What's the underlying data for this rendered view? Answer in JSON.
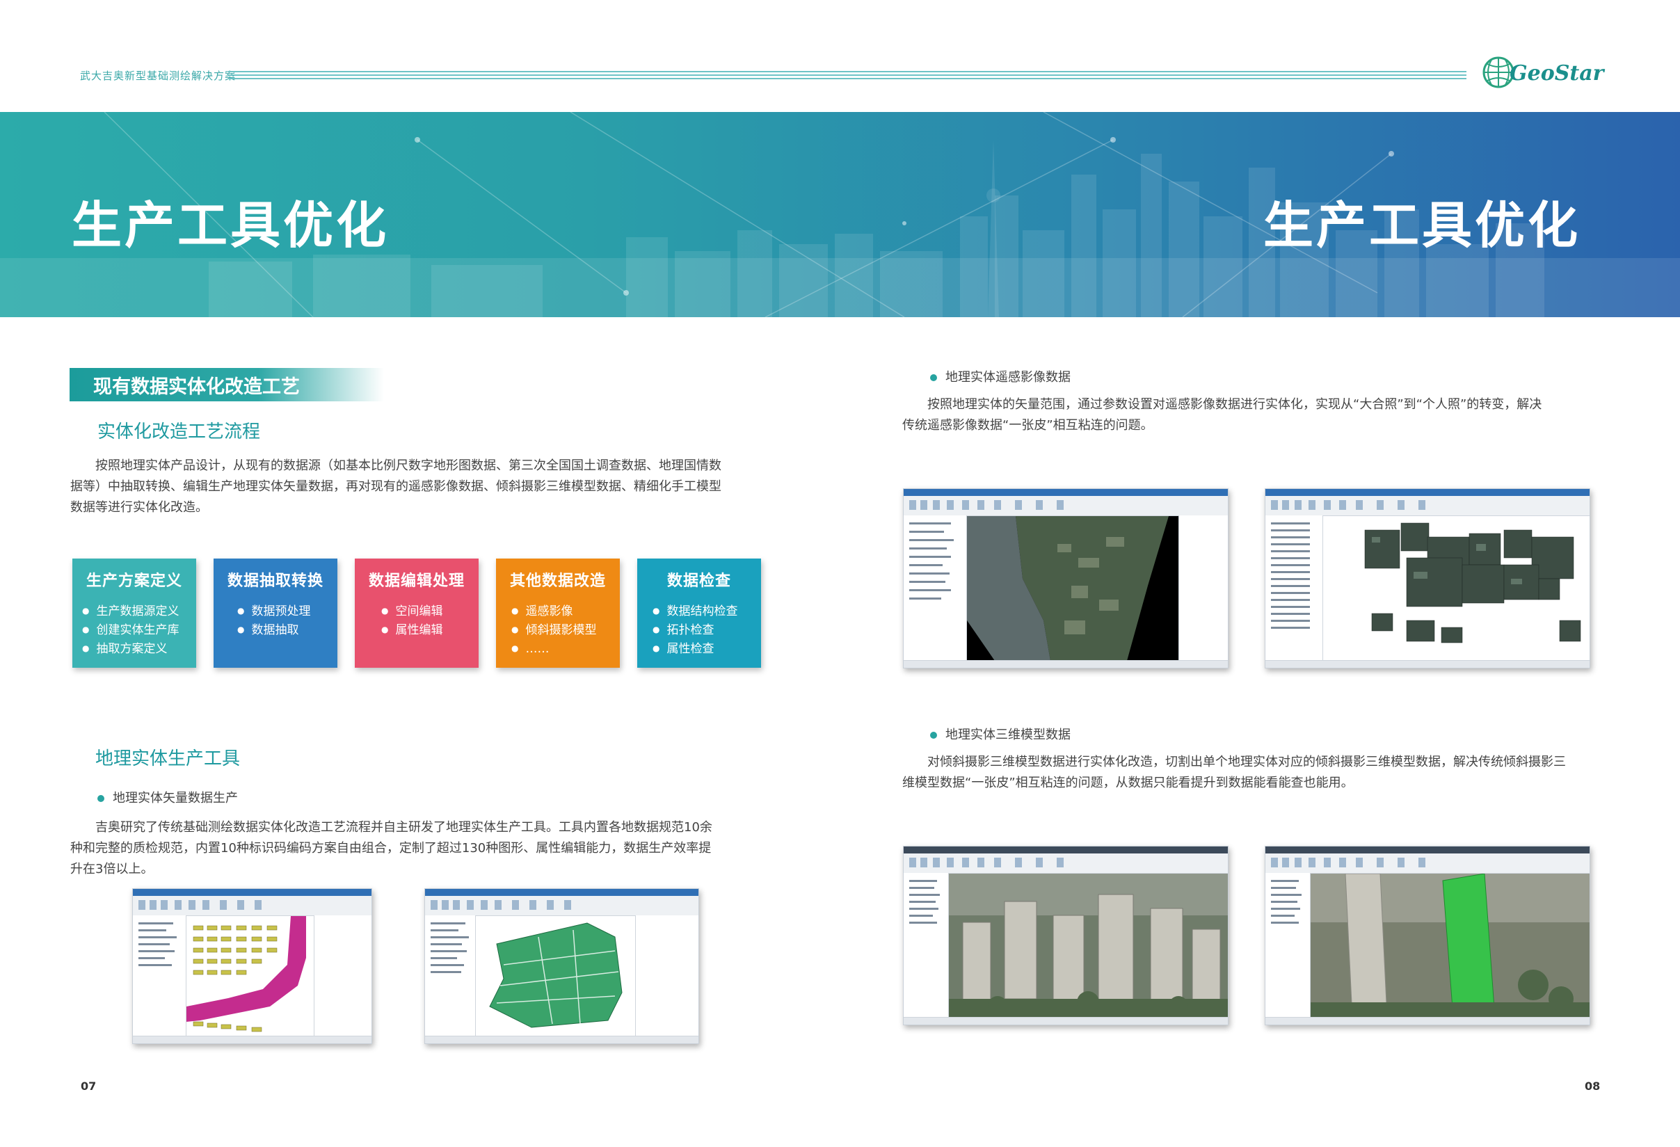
{
  "header": {
    "series_title": "武大吉奥新型基础测绘解决方案",
    "logo_text": "GeoStar"
  },
  "banner": {
    "title_left": "生产工具优化",
    "title_right": "生产工具优化"
  },
  "left": {
    "section_title": "现有数据实体化改造工艺",
    "process": {
      "title": "实体化改造工艺流程",
      "paragraph_lines": [
        "按照地理实体产品设计，从现有的数据源（如基本比例尺数字地形图数据、第三次全国国土调查数据、地理国情数",
        "据等）中抽取转换、编辑生产地理实体矢量数据，再对现有的遥感影像数据、倾斜摄影三维模型数据、精细化手工模型",
        "数据等进行实体化改造。"
      ]
    },
    "cards": [
      {
        "title": "生产方案定义",
        "items": [
          "生产数据源定义",
          "创建实体生产库",
          "抽取方案定义"
        ],
        "color": "#3bb3b4"
      },
      {
        "title": "数据抽取转换",
        "items": [
          "数据预处理",
          "数据抽取"
        ],
        "color": "#2f7fc3"
      },
      {
        "title": "数据编辑处理",
        "items": [
          "空间编辑",
          "属性编辑"
        ],
        "color": "#e8516d"
      },
      {
        "title": "其他数据改造",
        "items": [
          "遥感影像",
          "倾斜摄影模型",
          "……"
        ],
        "color": "#ef8a14"
      },
      {
        "title": "数据检查",
        "items": [
          "数据结构检查",
          "拓扑检查",
          "属性检查"
        ],
        "color": "#1aa1be"
      }
    ],
    "tools": {
      "title": "地理实体生产工具",
      "bullet": "地理实体矢量数据生产",
      "paragraph_lines": [
        "吉奥研究了传统基础测绘数据实体化改造工艺流程并自主研发了地理实体生产工具。工具内置各地数据规范10余",
        "种和完整的质检规范，内置10种标识码编码方案自由组合，定制了超过130种图形、属性编辑能力，数据生产效率提",
        "升在3倍以上。"
      ]
    },
    "page_number": "07"
  },
  "right": {
    "imagery": {
      "bullet": "地理实体遥感影像数据",
      "paragraph_lines": [
        "按照地理实体的矢量范围，通过参数设置对遥感影像数据进行实体化，实现从“大合照”到“个人照”的转变，解决",
        "传统遥感影像数据“一张皮”相互粘连的问题。"
      ]
    },
    "model": {
      "bullet": "地理实体三维模型数据",
      "paragraph_lines": [
        "对倾斜摄影三维模型数据进行实体化改造，切割出单个地理实体对应的倾斜摄影三维模型数据，解决传统倾斜摄影三",
        "维模型数据“一张皮”相互粘连的问题，从数据只能看提升到数据能看能查也能用。"
      ]
    },
    "page_number": "08"
  }
}
